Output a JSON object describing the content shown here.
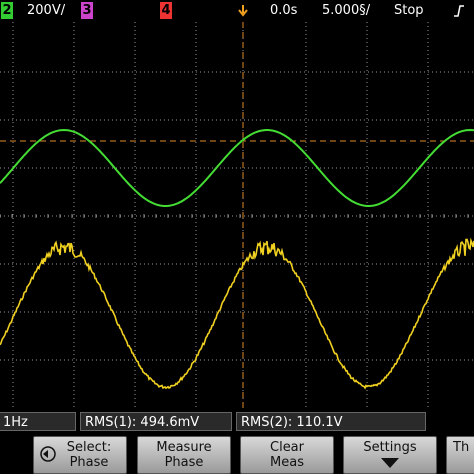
{
  "header": {
    "ch2_number": "2",
    "ch2_scale": "200V/",
    "ch3_number": "3",
    "ch4_number": "4",
    "trigger_marker_icon": "trigger-position-arrow-icon",
    "time_delay": "0.0s",
    "time_scale": "5.000§/",
    "run_state": "Stop",
    "trigger_slope_icon": "rising-edge-icon",
    "colors": {
      "ch2": "#33cc33",
      "ch3": "#cc44cc",
      "ch4": "#ee3333",
      "ch1": "#e8c81e"
    }
  },
  "measurements": {
    "freq_fragment": "1Hz",
    "rms1": "RMS(1): 494.6mV",
    "rms2": "RMS(2): 110.1V"
  },
  "softkeys": [
    {
      "icon": "rotary-knob-icon",
      "line1": "Select:",
      "line2": "Phase"
    },
    {
      "line1": "Measure",
      "line2": "Phase"
    },
    {
      "line1": "Clear",
      "line2": "Meas"
    },
    {
      "line1": "Settings",
      "icon": "down-arrow-icon"
    },
    {
      "line1": "Th"
    }
  ],
  "traces": {
    "ch2_color": "#44dd33",
    "ch1_color": "#f0d020",
    "grid_color": "#c8c8c8",
    "ref_line_color": "#e08a2a"
  }
}
